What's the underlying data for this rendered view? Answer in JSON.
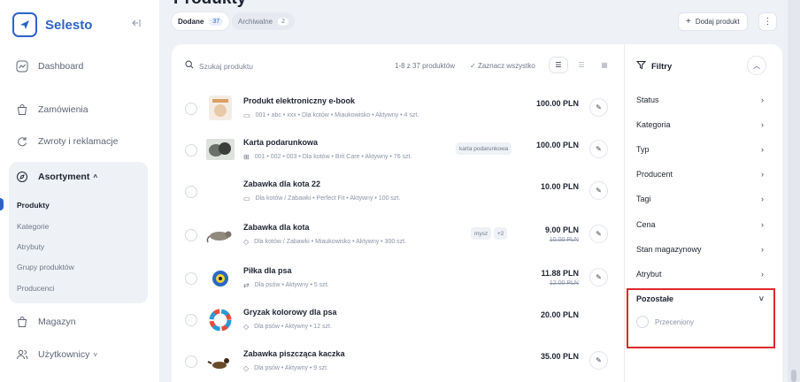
{
  "app": {
    "name": "Selesto"
  },
  "nav": {
    "dashboard": "Dashboard",
    "orders": "Zamówienia",
    "returns": "Zwroty i reklamacje",
    "assortment": "Asortyment",
    "assortment_chevron": "^",
    "sub": [
      "Produkty",
      "Kategorie",
      "Atrybuty",
      "Grupy produktów",
      "Producenci"
    ],
    "warehouse": "Magazyn",
    "users": "Użytkownicy",
    "users_chevron": "˅"
  },
  "header": {
    "title": "Produkty",
    "tabs": [
      {
        "label": "Dodane",
        "count": "37"
      },
      {
        "label": "Archiwalne",
        "count": "2"
      }
    ],
    "add_button": "Dodaj produkt"
  },
  "list": {
    "search_placeholder": "Szukaj produktu",
    "range": "1-8 z 37 produktów",
    "select_all": "Zaznacz wszystko",
    "products": [
      {
        "name": "Produkt elektroniczny e-book",
        "meta": "001  •  abc  •  xxx  •  Dla kotów  •  Miaukowisko  •  Aktywny  •  4 szt.",
        "price": "100.00 PLN",
        "old_price": "",
        "tags": []
      },
      {
        "name": "Karta podarunkowa",
        "meta": "001  •  002  •  003  •  Dla kotów  •  Brit Care  •  Aktywny  •  76 szt.",
        "price": "100.00 PLN",
        "old_price": "",
        "tags": [
          "karta podarunkowa"
        ]
      },
      {
        "name": "Zabawka dla kota 22",
        "meta": "Dla kotów / Zabawki  •  Perfect Fit  •  Aktywny  •  100 szt.",
        "price": "10.00 PLN",
        "old_price": "",
        "tags": []
      },
      {
        "name": "Zabawka dla kota",
        "meta": "Dla kotów / Zabawki  •  Miaukowisko  •  Aktywny  •  300 szt.",
        "price": "9.00 PLN",
        "old_price": "10.00 PLN",
        "tags": [
          "mysz",
          "+2"
        ]
      },
      {
        "name": "Piłka dla psa",
        "meta": "Dla psów  •  Aktywny  •  5 szt.",
        "price": "11.88 PLN",
        "old_price": "12.00 PLN",
        "tags": []
      },
      {
        "name": "Gryzak kolorowy dla psa",
        "meta": "Dla psów  •  Aktywny  •  12 szt.",
        "price": "20.00 PLN",
        "old_price": "",
        "tags": []
      },
      {
        "name": "Zabawka piszcząca kaczka",
        "meta": "Dla psów  •  Aktywny  •  9 szt.",
        "price": "35.00 PLN",
        "old_price": "",
        "tags": []
      }
    ]
  },
  "filters": {
    "title": "Filtry",
    "items": [
      "Status",
      "Kategoria",
      "Typ",
      "Producent",
      "Tagi",
      "Cena",
      "Stan magazynowy",
      "Atrybut"
    ],
    "other": "Pozostałe",
    "other_option": "Przeceniony"
  },
  "colors": {
    "accent": "#2c63c9",
    "highlight": "#e0262b",
    "background": "#eef1f5"
  }
}
